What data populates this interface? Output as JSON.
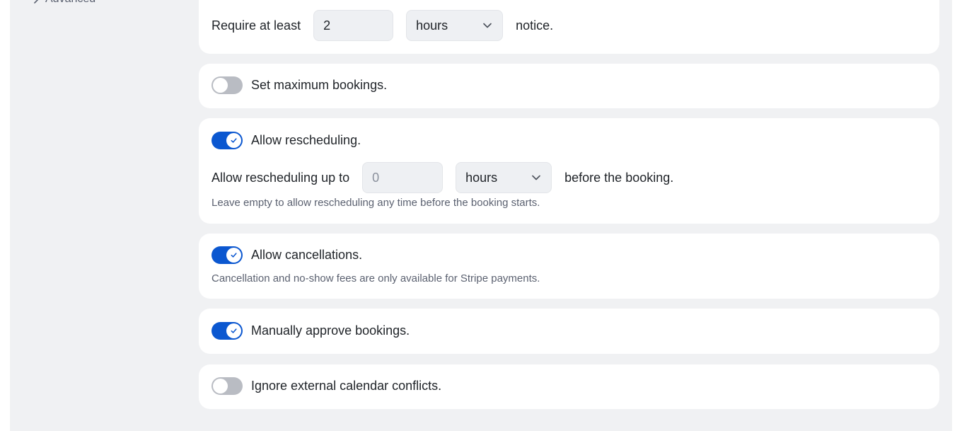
{
  "sidebar": {
    "advanced_label": "Advanced"
  },
  "notice": {
    "prefix": "Require at least",
    "value": "2",
    "unit": "hours",
    "suffix": "notice."
  },
  "max_bookings": {
    "label": "Set maximum bookings.",
    "enabled": false
  },
  "rescheduling": {
    "label": "Allow rescheduling.",
    "enabled": true,
    "prefix": "Allow rescheduling up to",
    "placeholder": "0",
    "unit": "hours",
    "suffix": "before the booking.",
    "hint": "Leave empty to allow rescheduling any time before the booking starts."
  },
  "cancellations": {
    "label": "Allow cancellations.",
    "enabled": true,
    "hint": "Cancellation and no-show fees are only available for Stripe payments."
  },
  "manual_approval": {
    "label": "Manually approve bookings.",
    "enabled": true
  },
  "external_conflicts": {
    "label": "Ignore external calendar conflicts.",
    "enabled": false
  },
  "colors": {
    "toggle_on": "#0b57d0",
    "toggle_off": "#b9bcc3",
    "page_bg": "#f0f1f3"
  }
}
